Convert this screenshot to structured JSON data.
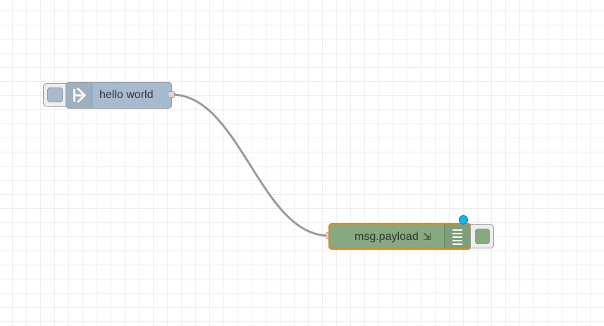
{
  "nodes": {
    "inject": {
      "label": "hello world",
      "color": "#a6bbcf",
      "icon": "inject-arrow-icon"
    },
    "debug": {
      "label": "msg.payload",
      "label_suffix": "⇲",
      "color": "#87a980",
      "selected_border_color": "#ff7f0e",
      "icon": "debug-list-icon",
      "changed_badge_color": "#00bcff"
    }
  },
  "wire": {
    "color": "#999999"
  },
  "colors": {
    "grid": "#eeeeee",
    "background": "#ffffff"
  }
}
